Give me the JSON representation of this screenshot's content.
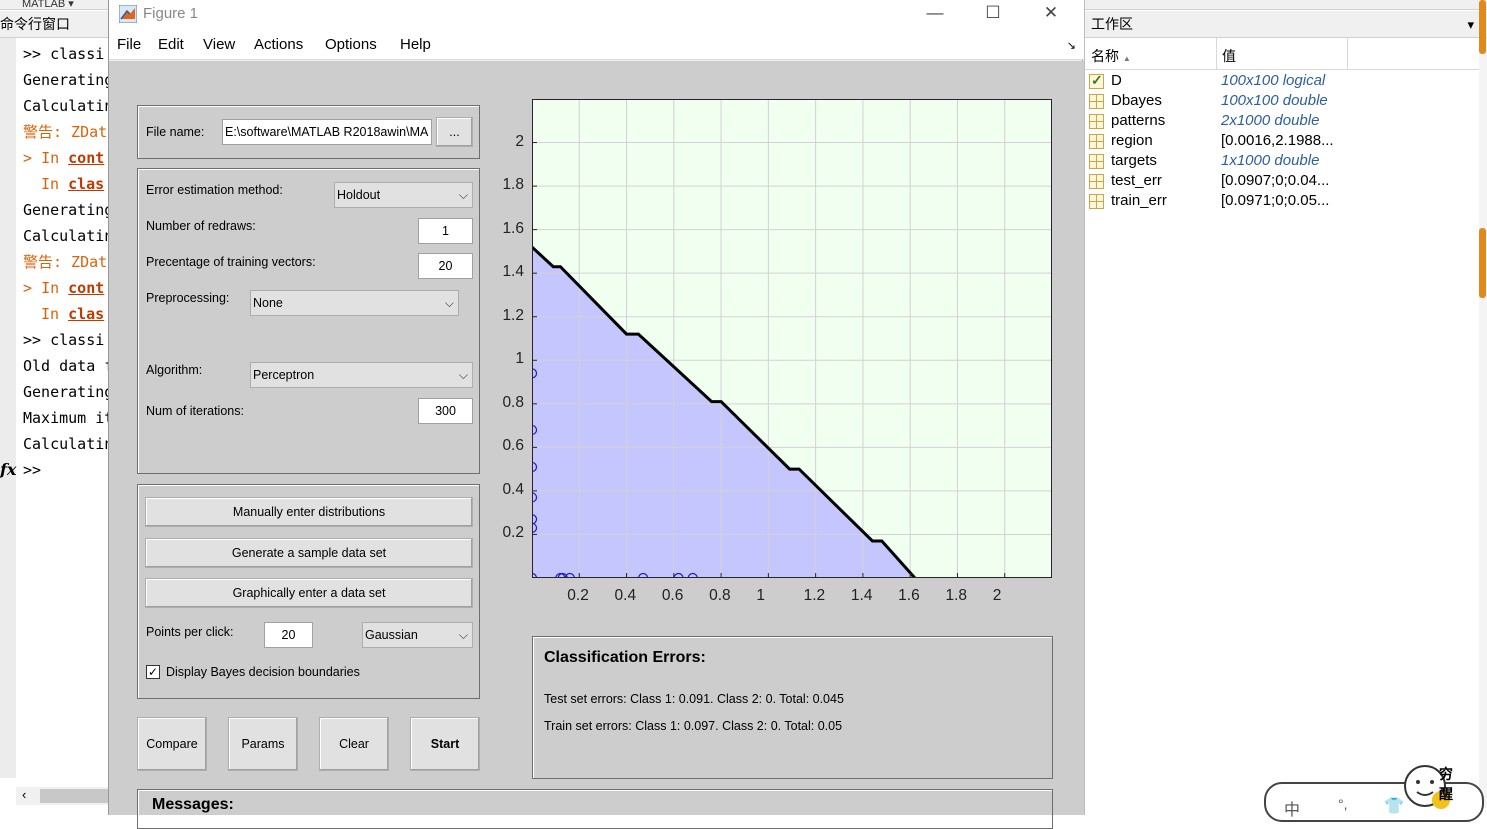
{
  "command_window": {
    "top_title": "MATLAB",
    "header": "命令行窗口",
    "lines": [
      {
        "text": ">>  classi",
        "kind": "normal"
      },
      {
        "text": "Generating",
        "kind": "normal"
      },
      {
        "text": "Calculatin",
        "kind": "normal"
      },
      {
        "text": "警告: ZDat",
        "kind": "warn"
      },
      {
        "prefix": "In ",
        "link": "cont",
        "kind": "link",
        "arrow": ">"
      },
      {
        "prefix": "In ",
        "link": "clas",
        "kind": "link",
        "arrow": ""
      },
      {
        "text": "Generating",
        "kind": "normal"
      },
      {
        "text": "Calculatin",
        "kind": "normal"
      },
      {
        "text": "警告: ZDat",
        "kind": "warn"
      },
      {
        "prefix": "In ",
        "link": "cont",
        "kind": "link",
        "arrow": ">"
      },
      {
        "prefix": "In ",
        "link": "clas",
        "kind": "link",
        "arrow": ""
      },
      {
        "text": ">>  classi",
        "kind": "normal"
      },
      {
        "text": "Old data f",
        "kind": "normal"
      },
      {
        "text": "Generating",
        "kind": "normal"
      },
      {
        "text": "Maximum it",
        "kind": "normal"
      },
      {
        "text": "Calculatin",
        "kind": "normal"
      },
      {
        "text": ">>",
        "kind": "normal"
      }
    ],
    "fx": "fx"
  },
  "figure": {
    "title": "Figure 1",
    "window_controls": {
      "minimize": "—",
      "maximize": "☐",
      "close": "✕"
    },
    "menu": [
      "File",
      "Edit",
      "View",
      "Actions",
      "Options",
      "Help"
    ],
    "dock_glyph": "↘",
    "file_panel": {
      "label": "File name:",
      "value": "E:\\software\\MATLAB R2018awin\\MA",
      "browse": "..."
    },
    "options_panel": {
      "error_method_label": "Error estimation method:",
      "error_method_value": "Holdout",
      "redraws_label": "Number of redraws:",
      "redraws_value": "1",
      "training_label": "Precentage of training vectors:",
      "training_value": "20",
      "preprocessing_label": "Preprocessing:",
      "preprocessing_value": "None",
      "algorithm_label": "Algorithm:",
      "algorithm_value": "Perceptron",
      "iterations_label": "Num of iterations:",
      "iterations_value": "300"
    },
    "data_panel": {
      "manual_button": "Manually enter distributions",
      "generate_button": "Generate a sample data set",
      "graphical_button": "Graphically enter a data set",
      "points_label": "Points per click:",
      "points_value": "20",
      "distribution_value": "Gaussian",
      "bayes_checkbox_label": "Display Bayes decision boundaries",
      "bayes_checked": true
    },
    "action_buttons": {
      "compare": "Compare",
      "params": "Params",
      "clear": "Clear",
      "start": "Start"
    },
    "errors_panel": {
      "title": "Classification Errors:",
      "test_line": "Test set errors: Class 1: 0.091. Class 2: 0. Total: 0.045",
      "train_line": "Train set errors: Class 1: 0.097. Class 2: 0. Total: 0.05"
    },
    "messages_label": "Messages:"
  },
  "chart_data": {
    "type": "area",
    "xlim": [
      0,
      2.2
    ],
    "ylim": [
      0,
      2.2
    ],
    "xticks": [
      0.2,
      0.4,
      0.6,
      0.8,
      1,
      1.2,
      1.4,
      1.6,
      1.8,
      2
    ],
    "yticks": [
      0.2,
      0.4,
      0.6,
      0.8,
      1,
      1.2,
      1.4,
      1.6,
      1.8,
      2
    ],
    "xtick_labels": [
      "0.2",
      "0.4",
      "0.6",
      "0.8",
      "1",
      "1.2",
      "1.4",
      "1.6",
      "1.8",
      "2"
    ],
    "ytick_labels": [
      "0.2",
      "0.4",
      "0.6",
      "0.8",
      "1",
      "1.2",
      "1.4",
      "1.6",
      "1.8",
      "2"
    ],
    "grid": true,
    "boundary": {
      "x": [
        0,
        0.09,
        0.12,
        0.4,
        0.45,
        0.76,
        0.8,
        1.09,
        1.13,
        1.44,
        1.48,
        1.62
      ],
      "y": [
        1.52,
        1.43,
        1.43,
        1.12,
        1.12,
        0.81,
        0.81,
        0.5,
        0.5,
        0.17,
        0.17,
        0
      ]
    },
    "region_colors": {
      "below": "#c6c6ff",
      "above": "#f0fff0"
    },
    "line_color": "#000000",
    "points": {
      "x": [
        0,
        0,
        0,
        0,
        0,
        0,
        0,
        0.12,
        0.13,
        0.16,
        0.47,
        0.62,
        0.68
      ],
      "y": [
        0.94,
        0.68,
        0.51,
        0.37,
        0.27,
        0.23,
        0,
        0,
        0,
        0,
        0,
        0,
        0
      ],
      "color": "#1a1ad6"
    }
  },
  "workspace": {
    "header": "工作区",
    "col_name": "名称",
    "col_value": "值",
    "sort_glyph": "▲",
    "rows": [
      {
        "name": "D",
        "value": "100x100 logical",
        "italic": true,
        "icon": "check"
      },
      {
        "name": "Dbayes",
        "value": "100x100 double",
        "italic": true,
        "icon": "grid"
      },
      {
        "name": "patterns",
        "value": "2x1000 double",
        "italic": true,
        "icon": "grid"
      },
      {
        "name": "region",
        "value": "[0.0016,2.1988...",
        "italic": false,
        "icon": "grid"
      },
      {
        "name": "targets",
        "value": "1x1000 double",
        "italic": true,
        "icon": "grid"
      },
      {
        "name": "test_err",
        "value": "[0.0907;0;0.04...",
        "italic": false,
        "icon": "grid"
      },
      {
        "name": "train_err",
        "value": "[0.0971;0;0.05...",
        "italic": false,
        "icon": "grid"
      }
    ],
    "ime": {
      "char1": "中",
      "char2": "°,",
      "badge": "穷醒"
    }
  }
}
